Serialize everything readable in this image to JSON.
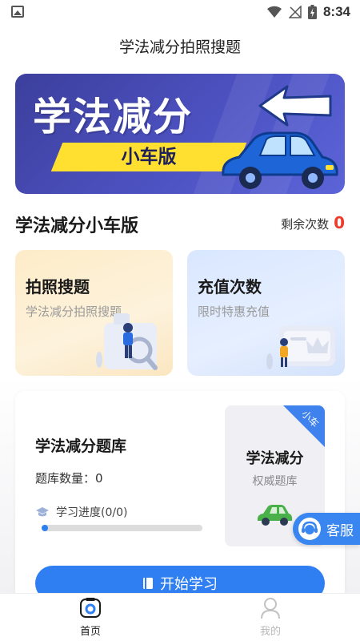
{
  "status_bar": {
    "time": "8:34"
  },
  "app": {
    "title": "学法减分拍照搜题"
  },
  "banner": {
    "title": "学法减分",
    "subtitle": "小车版"
  },
  "section": {
    "title": "学法减分小车版",
    "remaining_label": "剩余次数",
    "remaining_count": "0"
  },
  "cards": [
    {
      "title": "拍照搜题",
      "subtitle": "学法减分拍照搜题"
    },
    {
      "title": "充值次数",
      "subtitle": "限时特惠充值"
    }
  ],
  "library": {
    "title": "学法减分题库",
    "count_text": "题库数量：0",
    "progress_text": "学习进度(0/0)",
    "progress_fraction": 0.0,
    "tile_title": "学法减分",
    "tile_subtitle": "权威题库",
    "tile_badge": "小车",
    "start_button": "开始学习"
  },
  "service": {
    "label": "客服"
  },
  "nav": {
    "home": "首页",
    "mine": "我的"
  },
  "colors": {
    "accent": "#2f7ff2",
    "count_red": "#ee3b2b",
    "banner": "#4d52c2",
    "ribbon": "#ffe030"
  }
}
